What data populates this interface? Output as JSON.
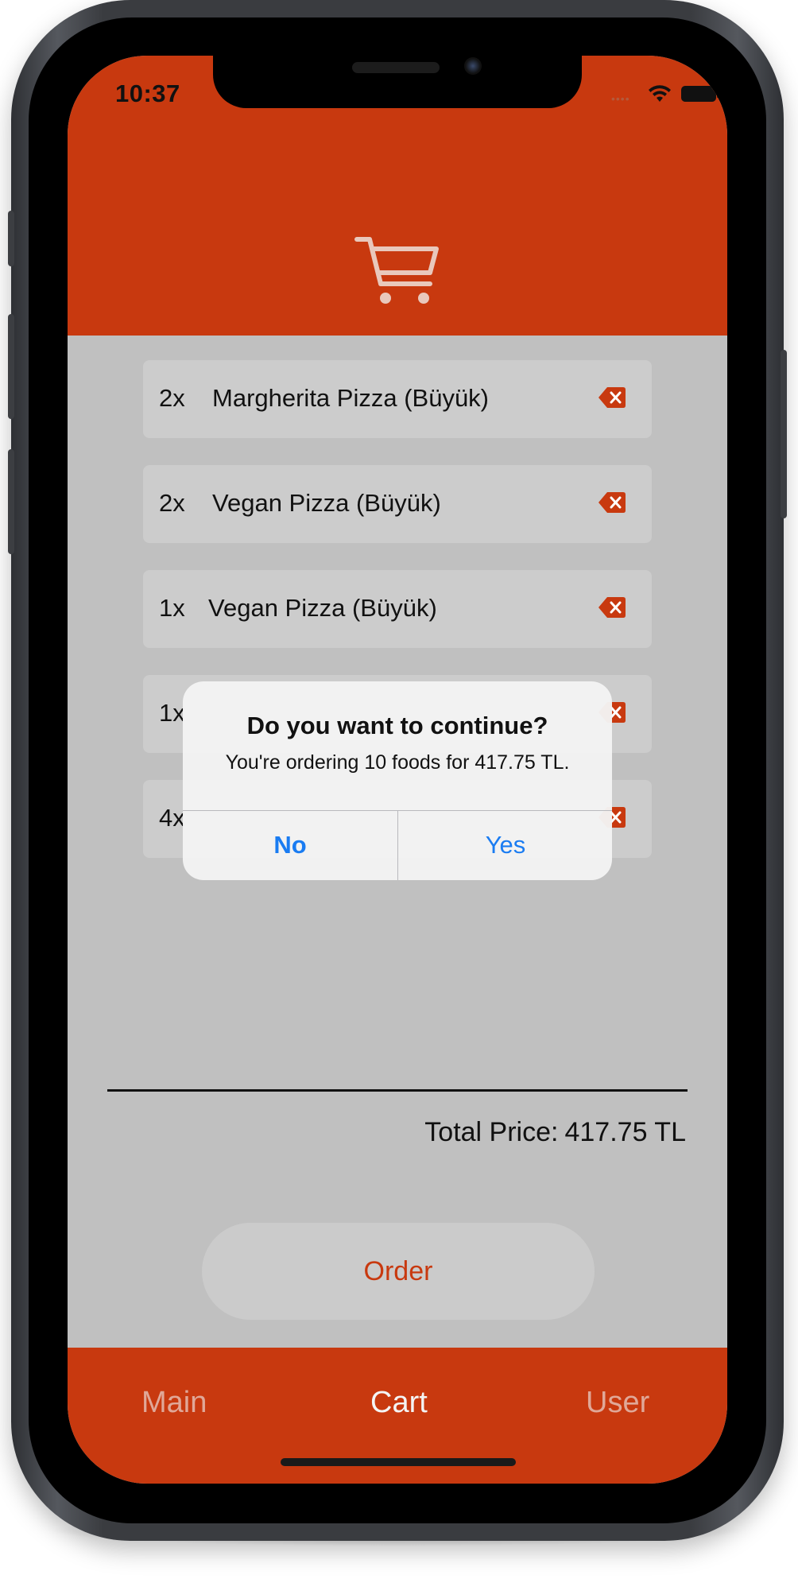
{
  "status_bar": {
    "time": "10:37"
  },
  "header": {
    "icon": "cart-icon"
  },
  "cart_items": [
    {
      "qty": "2x",
      "name": "Margherita Pizza (Büyük)"
    },
    {
      "qty": "2x",
      "name": "Vegan Pizza (Büyük)"
    },
    {
      "qty": "1x",
      "name": "Vegan Pizza (Büyük)"
    },
    {
      "qty": "1x",
      "name": ""
    },
    {
      "qty": "4x",
      "name": ""
    }
  ],
  "summary": {
    "total_label": "Total Price:",
    "total_value": "417.75 TL"
  },
  "order_button": {
    "label": "Order"
  },
  "tabs": [
    {
      "label": "Main"
    },
    {
      "label": "Cart"
    },
    {
      "label": "User"
    }
  ],
  "alert": {
    "title": "Do you want to continue?",
    "message": "You're ordering 10 foods for 417.75 TL.",
    "no_label": "No",
    "yes_label": "Yes"
  },
  "colors": {
    "brand": "#c8390f",
    "content_bg": "#c0c0c0",
    "link": "#1a7cf2"
  }
}
